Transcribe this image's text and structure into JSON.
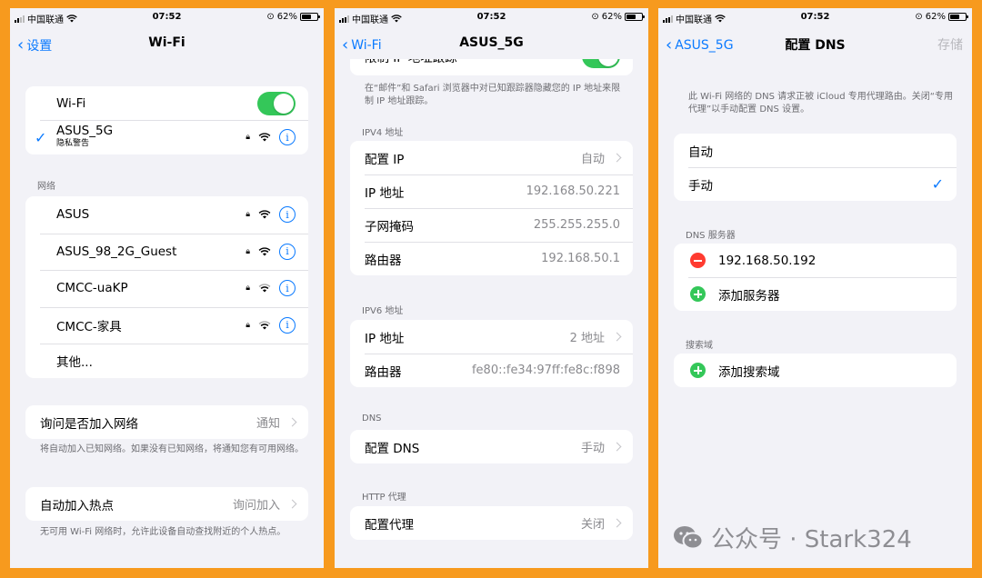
{
  "status": {
    "carrier": "中国联通",
    "time": "07:52",
    "battery": "62%"
  },
  "screen1": {
    "title": "Wi-Fi",
    "back": "设置",
    "wifi_label": "Wi-Fi",
    "connected": {
      "name": "ASUS_5G",
      "sub": "隐私警告"
    },
    "networks_header": "网络",
    "networks": [
      "ASUS",
      "ASUS_98_2G_Guest",
      "CMCC-uaKP",
      "CMCC-家具"
    ],
    "other": "其他...",
    "ask_join": {
      "label": "询问是否加入网络",
      "value": "通知"
    },
    "ask_join_footer": "将自动加入已知网络。如果没有已知网络，将通知您有可用网络。",
    "hotspot": {
      "label": "自动加入热点",
      "value": "询问加入"
    },
    "hotspot_footer": "无可用 Wi-Fi 网络时，允许此设备自动查找附近的个人热点。"
  },
  "screen2": {
    "title": "ASUS_5G",
    "back": "Wi-Fi",
    "limit_ip": "限制 IP 地址跟踪",
    "limit_footer": "在“邮件”和 Safari 浏览器中对已知跟踪器隐藏您的 IP 地址来限制 IP 地址跟踪。",
    "ipv4_header": "IPV4 地址",
    "ipv4": [
      {
        "label": "配置 IP",
        "value": "自动"
      },
      {
        "label": "IP 地址",
        "value": "192.168.50.221"
      },
      {
        "label": "子网掩码",
        "value": "255.255.255.0"
      },
      {
        "label": "路由器",
        "value": "192.168.50.1"
      }
    ],
    "ipv6_header": "IPV6 地址",
    "ipv6": [
      {
        "label": "IP 地址",
        "value": "2 地址"
      },
      {
        "label": "路由器",
        "value": "fe80::fe34:97ff:fe8c:f898"
      }
    ],
    "dns_header": "DNS",
    "dns": {
      "label": "配置 DNS",
      "value": "手动"
    },
    "proxy_header": "HTTP 代理",
    "proxy": {
      "label": "配置代理",
      "value": "关闭"
    }
  },
  "screen3": {
    "title": "配置 DNS",
    "back": "ASUS_5G",
    "save": "存储",
    "intro": "此 Wi-Fi 网络的 DNS 请求正被 iCloud 专用代理路由。关闭“专用代理”以手动配置 DNS 设置。",
    "mode_auto": "自动",
    "mode_manual": "手动",
    "dns_servers_header": "DNS 服务器",
    "dns_server": "192.168.50.192",
    "add_server": "添加服务器",
    "search_domains_header": "搜索域",
    "add_search_domain": "添加搜索域"
  },
  "watermark": "公众号 · Stark324"
}
